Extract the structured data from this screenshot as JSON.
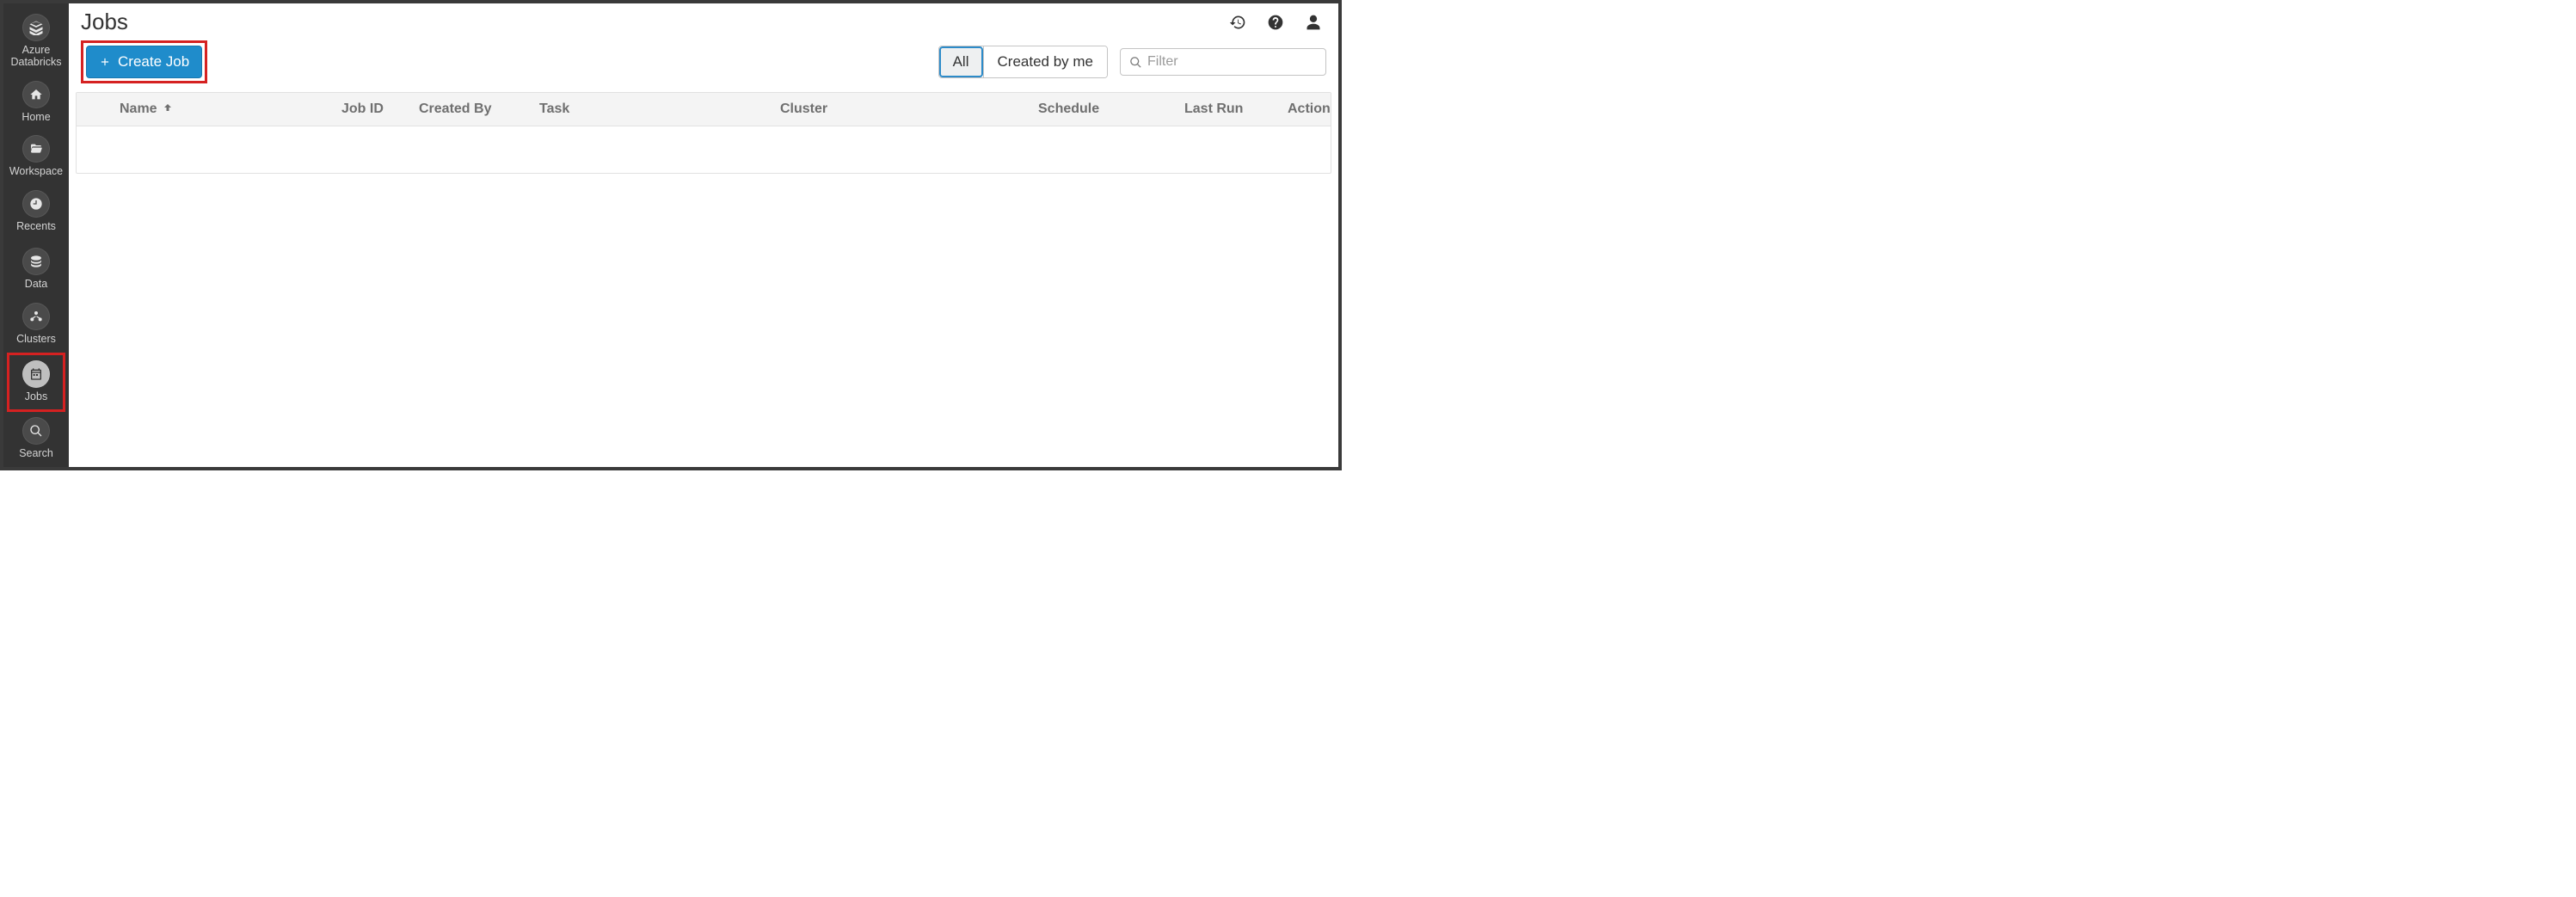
{
  "brand": "Azure Databricks",
  "sidebar": {
    "items": [
      {
        "label": "Home"
      },
      {
        "label": "Workspace"
      },
      {
        "label": "Recents"
      },
      {
        "label": "Data"
      },
      {
        "label": "Clusters"
      },
      {
        "label": "Jobs"
      },
      {
        "label": "Search"
      }
    ]
  },
  "page": {
    "title": "Jobs"
  },
  "toolbar": {
    "create_label": "Create Job",
    "filter_all": "All",
    "filter_mine": "Created by me",
    "filter_placeholder": "Filter"
  },
  "table": {
    "columns": {
      "name": "Name",
      "job_id": "Job ID",
      "created_by": "Created By",
      "task": "Task",
      "cluster": "Cluster",
      "schedule": "Schedule",
      "last_run": "Last Run",
      "action": "Action"
    },
    "rows": []
  }
}
